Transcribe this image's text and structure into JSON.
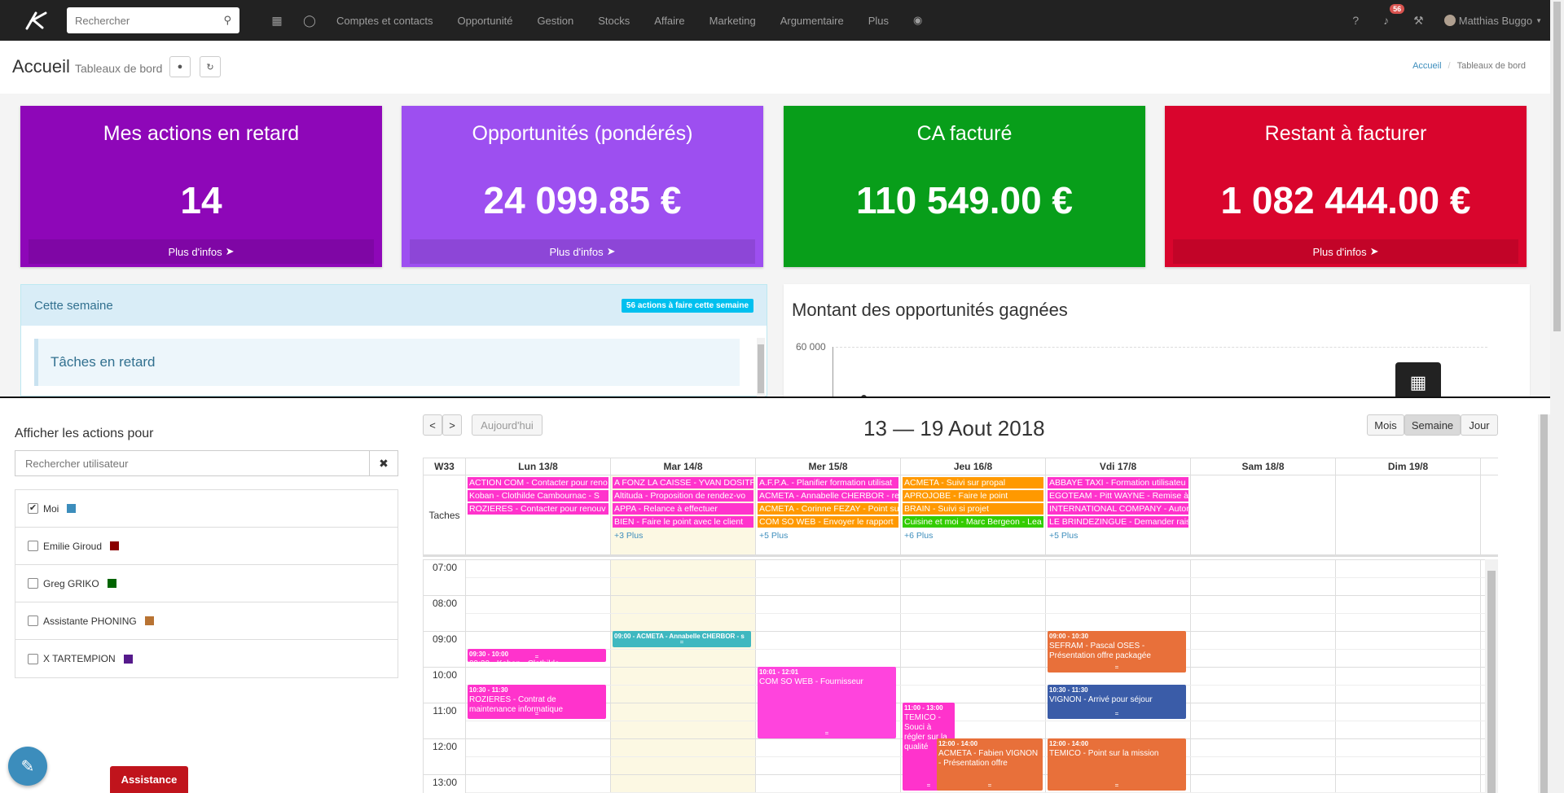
{
  "nav": {
    "search_placeholder": "Rechercher",
    "menu": [
      "Comptes et contacts",
      "Opportunité",
      "Gestion",
      "Stocks",
      "Affaire",
      "Marketing",
      "Argumentaire",
      "Plus"
    ],
    "notif_count": "56",
    "user_name": "Matthias Buggo"
  },
  "header": {
    "title": "Accueil",
    "subtitle": "Tableaux de bord",
    "breadcrumb_home": "Accueil",
    "breadcrumb_current": "Tableaux de bord"
  },
  "kpis": [
    {
      "title": "Mes actions en retard",
      "value": "14",
      "footer": "Plus d'infos",
      "color": "#8e07b8"
    },
    {
      "title": "Opportunités (pondérés)",
      "value": "24 099.85 €",
      "footer": "Plus d'infos",
      "color": "#9d4ff0"
    },
    {
      "title": "CA facturé",
      "value": "110 549.00 €",
      "footer": "",
      "color": "#089e1a"
    },
    {
      "title": "Restant à facturer",
      "value": "1 082 444.00 €",
      "footer": "Plus d'infos",
      "color": "#d9052d"
    }
  ],
  "week": {
    "title": "Cette semaine",
    "badge": "56 actions à faire cette semaine",
    "late_tasks": "Tâches en retard"
  },
  "won": {
    "title": "Montant des opportunités gagnées",
    "ytick": "60 000"
  },
  "sidebar": {
    "heading": "Afficher les actions pour",
    "search_placeholder": "Rechercher utilisateur",
    "users": [
      {
        "name": "Moi",
        "checked": true,
        "color": "#3c8dbc"
      },
      {
        "name": "Emilie Giroud",
        "checked": false,
        "color": "#8b0000"
      },
      {
        "name": "Greg GRIKO",
        "checked": false,
        "color": "#006400"
      },
      {
        "name": "Assistante PHONING",
        "checked": false,
        "color": "#b87333"
      },
      {
        "name": "X TARTEMPION",
        "checked": false,
        "color": "#551a8b"
      }
    ],
    "assistance": "Assistance"
  },
  "calendar": {
    "title": "13 — 19 Aout 2018",
    "today": "Aujourd'hui",
    "views": [
      "Mois",
      "Semaine",
      "Jour"
    ],
    "active_view": "Semaine",
    "week_label": "W33",
    "days": [
      "Lun 13/8",
      "Mar 14/8",
      "Mer 15/8",
      "Jeu 16/8",
      "Vdi 17/8",
      "Sam 18/8",
      "Dim 19/8"
    ],
    "tasks_label": "Taches",
    "hours": [
      "07:00",
      "08:00",
      "09:00",
      "10:00",
      "11:00",
      "12:00",
      "13:00"
    ],
    "allday": [
      [
        {
          "text": "ACTION COM - Contacter pour reno",
          "color": "#ff33cc"
        },
        {
          "text": "Koban - Clothilde Cambournac - S",
          "color": "#ff33cc"
        },
        {
          "text": "ROZIERES - Contacter pour renouv",
          "color": "#ff33cc"
        }
      ],
      [
        {
          "text": "A FONZ LA CAISSE - YVAN DOSITR -",
          "color": "#ff33cc"
        },
        {
          "text": "Altituda - Proposition de rendez-vo",
          "color": "#ff33cc"
        },
        {
          "text": "APPA - Relance à effectuer",
          "color": "#ff33cc"
        },
        {
          "text": "BIEN - Faire le point avec le client",
          "color": "#ff33cc"
        }
      ],
      [
        {
          "text": "A.F.P.A. - Planifier formation utilisat",
          "color": "#ff33cc"
        },
        {
          "text": "ACMETA - Annabelle CHERBOR - rel",
          "color": "#ff33cc"
        },
        {
          "text": "ACMETA - Corinne FEZAY - Point sui",
          "color": "#ff9900"
        },
        {
          "text": "COM SO WEB - Envoyer le rapport",
          "color": "#ff9900"
        }
      ],
      [
        {
          "text": "ACMETA - Suivi sur propal",
          "color": "#ff9900"
        },
        {
          "text": "APROJOBE - Faire le point",
          "color": "#ff9900"
        },
        {
          "text": "BRAIN - Suivi si projet",
          "color": "#ff9900"
        },
        {
          "text": "Cuisine et moi - Marc Bergeon - Lea",
          "color": "#33cc00"
        }
      ],
      [
        {
          "text": "ABBAYE TAXI - Formation utilisateu",
          "color": "#ff33cc"
        },
        {
          "text": "EGOTEAM - Pitt WAYNE - Remise à j",
          "color": "#ff33cc"
        },
        {
          "text": "INTERNATIONAL COMPANY - Autom",
          "color": "#ff33cc"
        },
        {
          "text": "LE BRINDEZINGUE - Demander rais",
          "color": "#ff33cc"
        }
      ],
      [],
      []
    ],
    "more": [
      "",
      "+3 Plus",
      "+5 Plus",
      "+6 Plus",
      "+5 Plus",
      "",
      ""
    ],
    "events": [
      {
        "day": 0,
        "start": 9.5,
        "end": 9.9,
        "time": "09:30 - 10:00",
        "text": "09:30 - Koban - Clothilde Cambournac -",
        "color": "#ff33cc",
        "inline": true
      },
      {
        "day": 0,
        "start": 10.5,
        "end": 11.5,
        "time": "10:30 - 11:30",
        "text": "ROZIERES - Contrat de maintenance informatique",
        "color": "#ff33cc"
      },
      {
        "day": 1,
        "start": 9.0,
        "end": 9.5,
        "time": "09:00 - ACMETA - Annabelle CHERBOR - s",
        "text": "",
        "color": "#3fb8c0",
        "inline": true
      },
      {
        "day": 2,
        "start": 10.0,
        "end": 12.05,
        "time": "10:01 - 12:01",
        "text": "COM SO WEB - Fournisseur",
        "color": "#ff44dd"
      },
      {
        "day": 3,
        "start": 11.0,
        "end": 13.5,
        "time": "11:00 - 13:00",
        "text": "TEMICO - Souci à régler sur la qualité",
        "color": "#ff33cc",
        "narrow": true
      },
      {
        "day": 3,
        "start": 12.0,
        "end": 13.5,
        "time": "12:00 - 14:00",
        "text": "ACMETA - Fabien VIGNON - Présentation offre",
        "color": "#e8703a",
        "offset": true
      },
      {
        "day": 4,
        "start": 9.0,
        "end": 10.2,
        "time": "09:00 - 10:30",
        "text": "SEFRAM - Pascal OSES - Présentation offre packagée",
        "color": "#e8703a"
      },
      {
        "day": 4,
        "start": 10.5,
        "end": 11.5,
        "time": "10:30 - 11:30",
        "text": "VIGNON - Arrivé pour séjour",
        "color": "#3a5ca8"
      },
      {
        "day": 4,
        "start": 12.0,
        "end": 13.5,
        "time": "12:00 - 14:00",
        "text": "TEMICO - Point sur la mission",
        "color": "#e8703a"
      }
    ]
  }
}
